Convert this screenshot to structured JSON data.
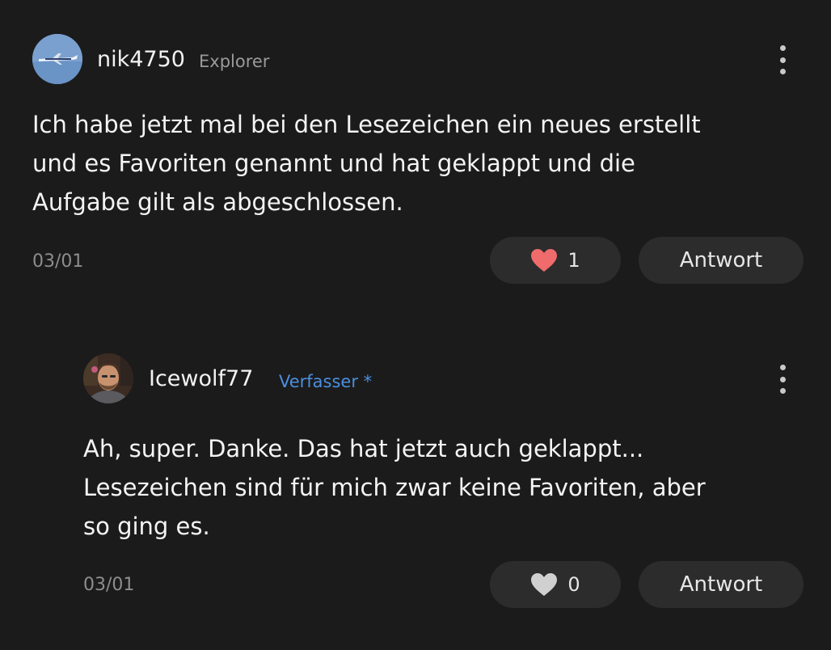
{
  "comments": [
    {
      "username": "nik4750",
      "tag": "Explorer",
      "text": "Ich habe jetzt mal bei den Lesezeichen ein neues erstellt\nund es Favoriten genannt und hat geklappt und die\nAufgabe gilt als abgeschlossen.",
      "date": "03/01",
      "likes": "1",
      "liked": true,
      "reply_label": "Antwort",
      "avatar_icon": "airplane-avatar"
    },
    {
      "username": "Icewolf77",
      "tag": "Verfasser *",
      "text": "Ah, super. Danke. Das hat jetzt auch geklappt...\nLesezeichen sind für mich zwar keine Favoriten, aber\nso ging es.",
      "date": "03/01",
      "likes": "0",
      "liked": false,
      "reply_label": "Antwort",
      "avatar_icon": "person-avatar"
    }
  ],
  "colors": {
    "background": "#1b1b1b",
    "button_bg": "#2c2c2c",
    "heart_liked": "#f06b6b",
    "heart_unliked": "#d0d0d0",
    "author_tag": "#4a8fe0"
  }
}
